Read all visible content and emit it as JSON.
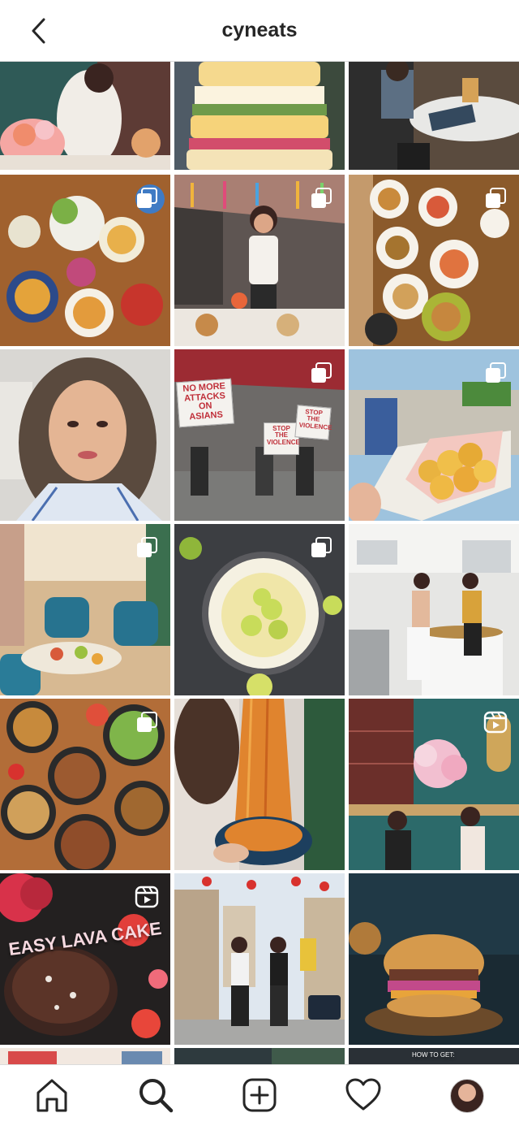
{
  "header": {
    "title": "cyneats",
    "back_icon": "chevron-left-icon"
  },
  "grid": {
    "tiles": [
      {
        "subject": "woman in white dress at flower-decorated cafe table",
        "type": "photo"
      },
      {
        "subject": "stacked egg sandwiches",
        "type": "photo"
      },
      {
        "subject": "cafe table with menu",
        "type": "photo"
      },
      {
        "subject": "overhead spread of Thai dishes",
        "type": "carousel"
      },
      {
        "subject": "woman in white top eating in restaurant with hanging decorations",
        "type": "carousel"
      },
      {
        "subject": "brunch plates on wooden table",
        "type": "carousel"
      },
      {
        "subject": "selfie portrait",
        "type": "photo"
      },
      {
        "subject": "rally with protest signs",
        "type": "carousel",
        "signs": [
          "NO MORE ATTACKS ON ASIANS",
          "STOP THE VIOLENCE",
          "STOP THE VIOLENCE"
        ]
      },
      {
        "subject": "box of pastries held over city view",
        "type": "carousel"
      },
      {
        "subject": "restaurant interior with teal velvet chairs",
        "type": "carousel"
      },
      {
        "subject": "key lime pie with whipped cream",
        "type": "carousel"
      },
      {
        "subject": "two women preparing a table outdoors",
        "type": "photo"
      },
      {
        "subject": "overhead spread of pho bowls",
        "type": "carousel"
      },
      {
        "subject": "noodles lifted with chopsticks",
        "type": "photo"
      },
      {
        "subject": "couple in floral decorated restaurant",
        "type": "reel"
      },
      {
        "subject": "chocolate lava cake",
        "type": "reel",
        "overlay": "EASY LAVA CAKE"
      },
      {
        "subject": "couple posing on Chinatown street",
        "type": "photo"
      },
      {
        "subject": "pulled pork burger",
        "type": "photo"
      },
      {
        "subject": "partial tile",
        "type": "photo"
      },
      {
        "subject": "partial tile",
        "type": "photo"
      },
      {
        "subject": "partial tile",
        "type": "photo",
        "overlay": "HOW TO GET:"
      }
    ]
  },
  "bottom_nav": {
    "items": [
      {
        "icon": "home-icon",
        "active": false
      },
      {
        "icon": "search-icon",
        "active": true
      },
      {
        "icon": "new-post-icon",
        "active": false
      },
      {
        "icon": "heart-icon",
        "active": false
      },
      {
        "icon": "profile-avatar",
        "active": false
      }
    ]
  },
  "colors": {
    "text": "#262626",
    "divider": "#dbdbdb",
    "background": "#ffffff"
  }
}
